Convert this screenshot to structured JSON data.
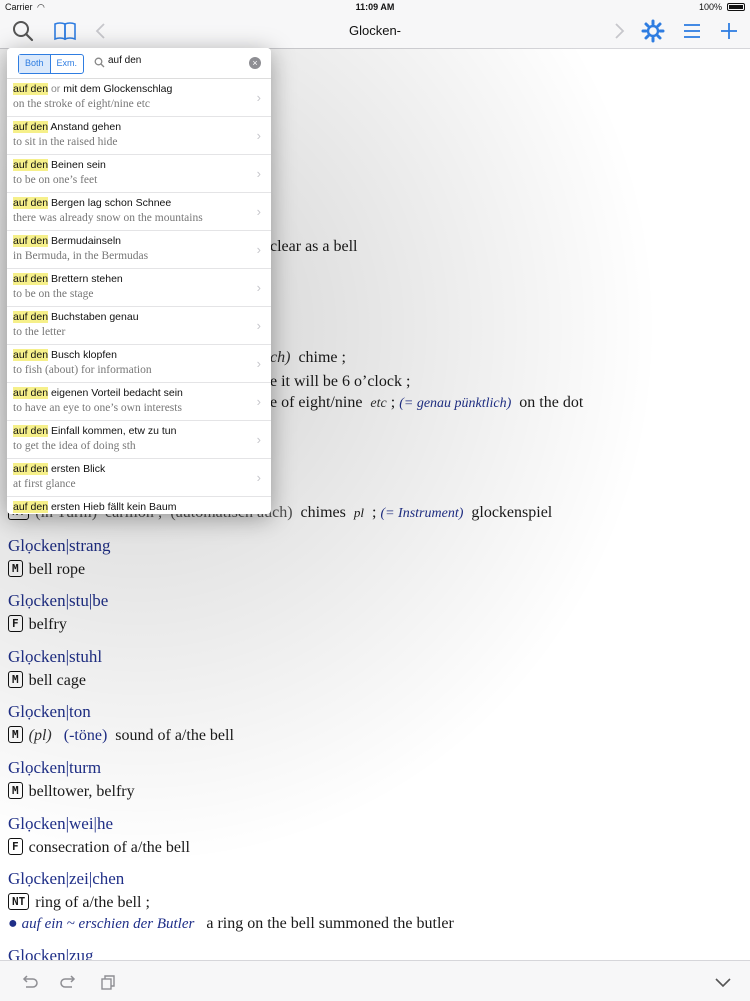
{
  "status": {
    "carrier": "Carrier",
    "time": "11:09 AM",
    "battery": "100%"
  },
  "nav": {
    "title": "Glocken-",
    "accent": "#2f7de1"
  },
  "search": {
    "seg_both": "Both",
    "seg_exm": "Exm.",
    "query": "auf den",
    "results": [
      {
        "hl": "auf den",
        "or": "or",
        "rest": "mit dem Glockenschlag",
        "en": "on the stroke of eight/nine etc"
      },
      {
        "hl": "auf den",
        "or": "",
        "rest": "Anstand gehen",
        "en": "to sit in the raised hide"
      },
      {
        "hl": "auf den",
        "or": "",
        "rest": "Beinen sein",
        "en": "to be on one’s feet"
      },
      {
        "hl": "auf den",
        "or": "",
        "rest": "Bergen lag schon Schnee",
        "en": "there was already snow on the mountains"
      },
      {
        "hl": "auf den",
        "or": "",
        "rest": "Bermudainseln",
        "en": "in Bermuda, in the Bermudas"
      },
      {
        "hl": "auf den",
        "or": "",
        "rest": "Brettern stehen",
        "en": "to be on the stage"
      },
      {
        "hl": "auf den",
        "or": "",
        "rest": "Buchstaben genau",
        "en": "to the letter"
      },
      {
        "hl": "auf den",
        "or": "",
        "rest": "Busch klopfen",
        "en": "to fish (about) for information"
      },
      {
        "hl": "auf den",
        "or": "",
        "rest": "eigenen Vorteil bedacht sein",
        "en": "to have an eye to one’s own interests"
      },
      {
        "hl": "auf den",
        "or": "",
        "rest": "Einfall kommen, etw zu tun",
        "en": "to get the idea of doing sth"
      },
      {
        "hl": "auf den",
        "or": "",
        "rest": "ersten Blick",
        "en": "at first glance"
      },
      {
        "hl": "auf den",
        "or": "",
        "rest": "ersten Hieb fällt kein Baum",
        "en": ""
      }
    ]
  },
  "fragments": {
    "f1": "clear as a bell",
    "f2a": "ch)",
    "f2b": "chime ;",
    "f3": "e it will be 6 o’clock ;",
    "f4a": "e of eight/nine",
    "f4b": "etc",
    "f4c": ";",
    "f4d": "(= genau pünktlich)",
    "f4e": "on the dot",
    "f5a": "NT",
    "f5b": "(in Turm)",
    "f5c": "carillon ;",
    "f5d": "(automatisch auch)",
    "f5e": "chimes",
    "f5f": "pl",
    "f5g": ";",
    "f5h": "(= Instrument)",
    "f5i": "glockenspiel"
  },
  "entries": [
    {
      "headword": "Glọcken|strang",
      "gender": "M",
      "translation": "bell rope"
    },
    {
      "headword": "Glọcken|stu|be",
      "gender": "F",
      "translation": "belfry"
    },
    {
      "headword": "Glọcken|stuhl",
      "gender": "M",
      "translation": "bell cage"
    },
    {
      "headword": "Glọcken|ton",
      "gender": "M",
      "pl": "(pl)",
      "plform": "(-töne)",
      "translation": "sound of a/the bell"
    },
    {
      "headword": "Glọcken|turm",
      "gender": "M",
      "translation": "belltower, belfry"
    },
    {
      "headword": "Glọcken|wei|he",
      "gender": "F",
      "translation": "consecration of a/the bell"
    },
    {
      "headword": "Glọcken|zei|chen",
      "gender": "NT",
      "translation": "ring of a/the bell ;",
      "example_de": "auf ein ~ erschien der Butler",
      "example_en": "a ring on the bell summoned the butler"
    },
    {
      "headword": "Glọcken|zug"
    }
  ]
}
